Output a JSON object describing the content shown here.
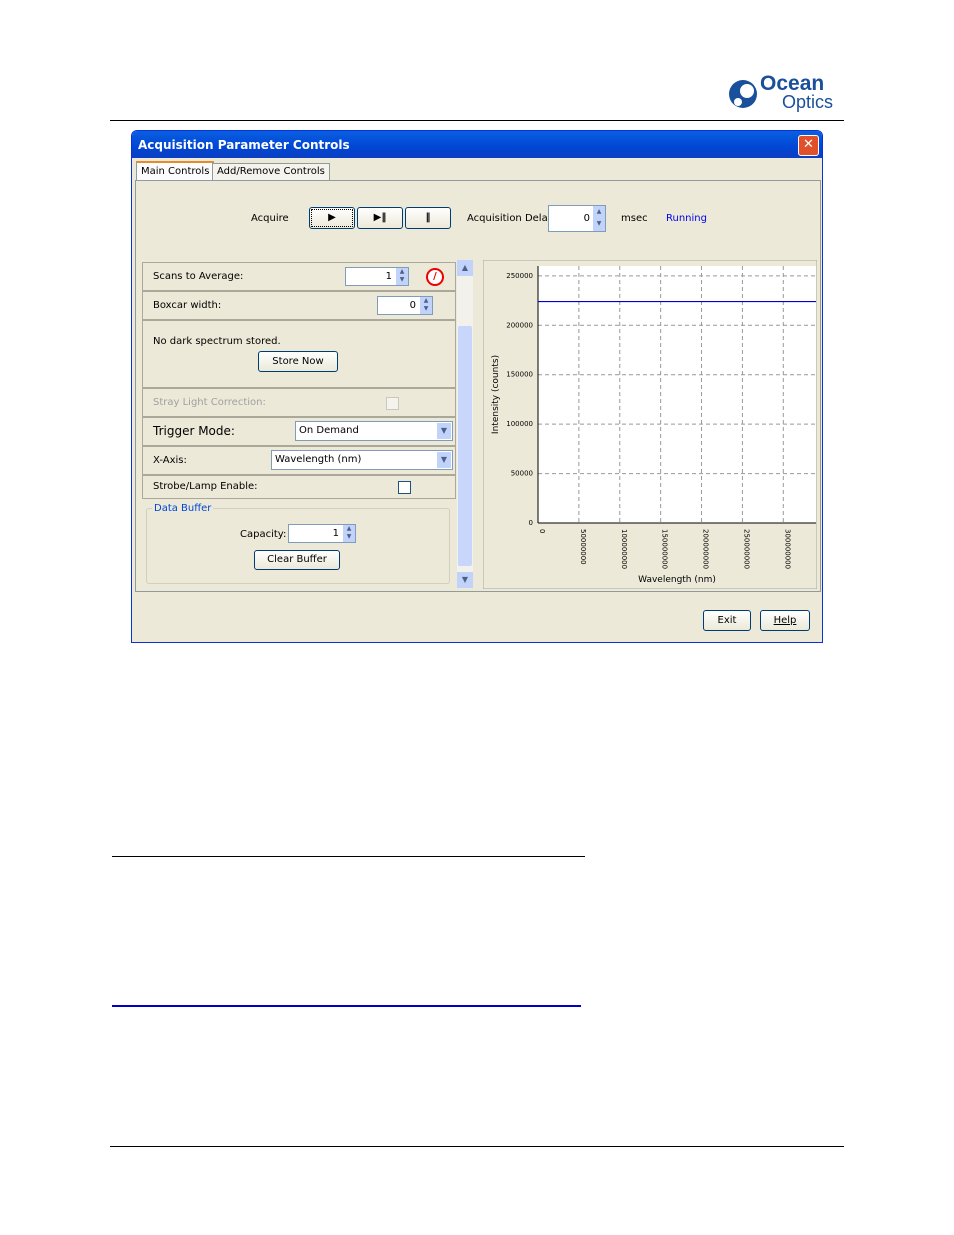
{
  "logo": {
    "text": "Ocean Optics",
    "line1": "Ocean",
    "line2": "Optics"
  },
  "dialog": {
    "title": "Acquisition Parameter Controls",
    "tabs": [
      {
        "label": "Main Controls",
        "active": true
      },
      {
        "label": "Add/Remove Controls",
        "active": false
      }
    ],
    "acquire_label": "Acquire",
    "acq_delay_label": "Acquisition Delay",
    "acq_delay_value": "0",
    "acq_delay_unit": "msec",
    "status": "Running",
    "scans_label": "Scans to Average:",
    "scans_value": "1",
    "boxcar_label": "Boxcar width:",
    "boxcar_value": "0",
    "dark_text": "No dark spectrum stored.",
    "store_now": "Store Now",
    "stray_label": "Stray Light Correction:",
    "trigger_label": "Trigger Mode:",
    "trigger_value": "On Demand",
    "xaxis_label": "X-Axis:",
    "xaxis_value": "Wavelength (nm)",
    "strobe_label": "Strobe/Lamp Enable:",
    "buffer_legend": "Data Buffer",
    "capacity_label": "Capacity:",
    "capacity_value": "1",
    "clear_buffer": "Clear Buffer",
    "exit": "Exit",
    "help": "Help"
  },
  "chart_data": {
    "type": "line",
    "xlabel": "Wavelength (nm)",
    "ylabel": "Intensity (counts)",
    "xlim": [
      0,
      340000000
    ],
    "ylim": [
      0,
      260000
    ],
    "xticks": [
      "0",
      "50000000",
      "100000000",
      "150000000",
      "200000000",
      "250000000",
      "300000000"
    ],
    "yticks": [
      "0",
      "50000",
      "100000",
      "150000",
      "200000",
      "250000"
    ],
    "grid": true,
    "series": [
      {
        "x": [
          0,
          340000000
        ],
        "y": [
          224000,
          224000
        ],
        "color": "#0000cc"
      }
    ]
  }
}
